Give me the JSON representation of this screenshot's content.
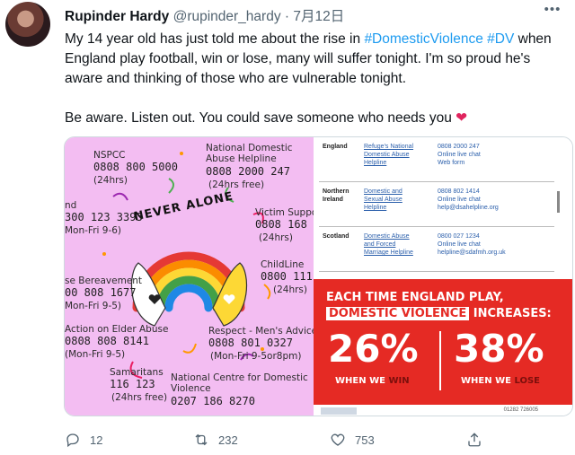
{
  "tweet": {
    "author_name": "Rupinder Hardy",
    "handle": "@rupinder_hardy",
    "separator": "·",
    "date": "7月12日",
    "text_before_tags": "My 14 year old has just told me about the rise in ",
    "hashtag1": "#DomesticViolence",
    "hashtag2": "#DV",
    "text_after_tags": " when England play football, win or lose, many will suffer tonight. I'm so proud he's aware and thinking of those who are vulnerable tonight.",
    "paragraph2": "Be aware. Listen out. You could save someone who needs you",
    "heart_emoji": "❤"
  },
  "poster_left": {
    "slogan": "NEVER ALONE",
    "nspcc_label": "NSPCC",
    "nspcc_number": "0808 800 5000",
    "nspcc_hours": "(24hrs)",
    "nda_label": "National Domestic\nAbuse Helpline",
    "nda_number": "0808 2000 247",
    "nda_hours": "(24hrs free)",
    "left_partial_label": "nd",
    "left_partial_number": "300 123 3393",
    "left_partial_hours": "Mon-Fri 9-6)",
    "victim_label": "Victim Suppor",
    "victim_number": "0808 168 9",
    "victim_hours": "(24hrs)",
    "childline_label": "ChildLine",
    "childline_number": "0800 1111",
    "childline_hours": "(24hrs)",
    "bereavement_label": "se Bereavement",
    "bereavement_number": "00 808 1677",
    "bereavement_hours": "Mon-Fri 9-5)",
    "elder_label": "Action on Elder Abuse",
    "elder_number": "0808 808 8141",
    "elder_hours": "(Mon-Fri 9-5)",
    "respect_label": "Respect - Men's Advice L",
    "respect_number": "0808 801 0327",
    "respect_hours": "(Mon-Fri 9-5or8pm)",
    "samaritans_label": "Samaritans",
    "samaritans_number": "116 123",
    "samaritans_hours": "(24hrs free)",
    "ncdv_label": "National Centre for Domestic\nViolence",
    "ncdv_number": "0207 186 8270"
  },
  "poster_right": {
    "rows": [
      {
        "country": "England",
        "name": "Refuge's National\nDomestic Abuse\nHelpline",
        "contact": "0808 2000 247\nOnline live chat\nWeb form"
      },
      {
        "country": "Northern\nIreland",
        "name": "Domestic and\nSexual Abuse\nHelpline",
        "contact": "0808 802 1414\nOnline live chat\nhelp@dsahelpline.org"
      },
      {
        "country": "Scotland",
        "name": "Domestic Abuse\nand Forced\nMarriage Helpline",
        "contact": "0800 027 1234\nOnline live chat\nhelpline@sdafmh.org.uk"
      }
    ],
    "headline_line1": "EACH TIME ENGLAND PLAY,",
    "headline_highlight": "DOMESTIC VIOLENCE",
    "headline_end": " INCREASES:",
    "win_pct": "26%",
    "lose_pct": "38%",
    "win_caption_a": "WHEN WE ",
    "win_caption_b": "WIN",
    "lose_caption_a": "WHEN WE ",
    "lose_caption_b": "LOSE",
    "footer_text": "01282 726005"
  },
  "actions": {
    "reply_count": "12",
    "retweet_count": "232",
    "like_count": "753"
  },
  "colors": {
    "hashtag": "#1d9bf0",
    "poster_pink": "#f3bdf2",
    "poster_red": "#e52a24",
    "muted": "#536471"
  }
}
